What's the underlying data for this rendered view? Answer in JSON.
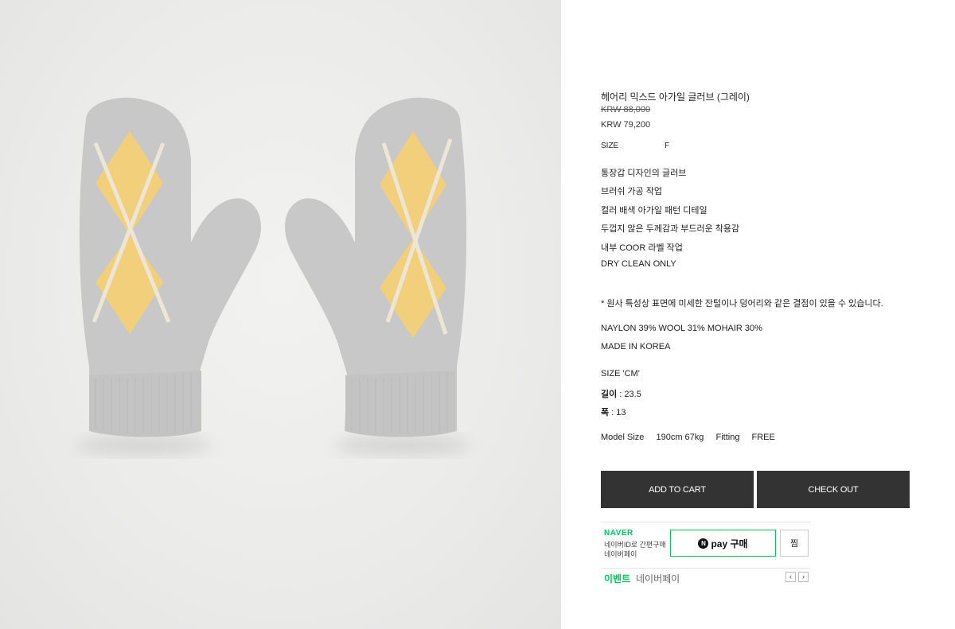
{
  "product": {
    "title": "헤어리 믹스드 아가일 글러브 (그레이)",
    "original_price": "KRW 88,000",
    "price": "KRW 79,200",
    "size_label": "SIZE",
    "size_value": "F"
  },
  "description": {
    "features": [
      "통장갑 디자인의 글러브",
      "브러쉬 가공 작업",
      "컬러 배색 아가일 패턴 디테일",
      "두껍지 않은 두께감과 부드러운 착용감",
      "내부 COOR 라벨 작업",
      "DRY CLEAN ONLY"
    ],
    "notice": "* 원사 특성상 표면에 미세한 잔털이나 덩어리와 같은 결점이 있을 수 있습니다.",
    "material": "NAYLON 39% WOOL 31% MOHAIR 30%",
    "origin": "MADE IN KOREA",
    "size_unit": "SIZE 'CM'",
    "length_label": "길이",
    "length_value": " : 23.5",
    "width_label": "폭",
    "width_value": " : 13",
    "model": {
      "label": "Model Size",
      "value": "190cm 67kg",
      "fitting_label": "Fitting",
      "fitting_value": "FREE"
    }
  },
  "actions": {
    "add_to_cart": "ADD TO CART",
    "check_out": "CHECK OUT"
  },
  "naver_pay": {
    "brand": "NAVER",
    "sub1": "네이버ID로 간편구매",
    "sub2": "네이버페이",
    "button_n": "N",
    "button_label": "pay 구매",
    "wish": "찜",
    "event_label": "이벤트",
    "event_text": "네이버페이",
    "prev": "‹",
    "next": "›"
  },
  "colors": {
    "button_bg": "#333333",
    "naver_green": "#03c75a",
    "mitten_gray": "#c9c9c9",
    "argyle_yellow": "#f2cf7a"
  }
}
